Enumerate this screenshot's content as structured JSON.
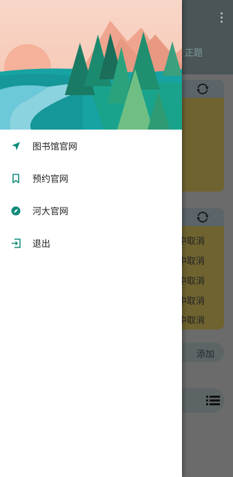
{
  "background_app": {
    "tab_label": "正题",
    "card2_rows": [
      "中取消",
      "中取消",
      "中取消",
      "中取消",
      "中取消"
    ],
    "add_button_label": "添加",
    "icons": [
      "more-vert-icon",
      "refresh-icon",
      "list-icon"
    ]
  },
  "drawer": {
    "items": [
      {
        "label": "图书馆官网",
        "icon": "navigation-arrow-icon"
      },
      {
        "label": "预约官网",
        "icon": "bookmark-icon"
      },
      {
        "label": "河大官网",
        "icon": "compass-icon"
      },
      {
        "label": "退出",
        "icon": "logout-icon"
      }
    ]
  },
  "colors": {
    "accent": "#0f8a7a",
    "scrim": "#6b6b6b",
    "card_bg": "#6f6330"
  }
}
